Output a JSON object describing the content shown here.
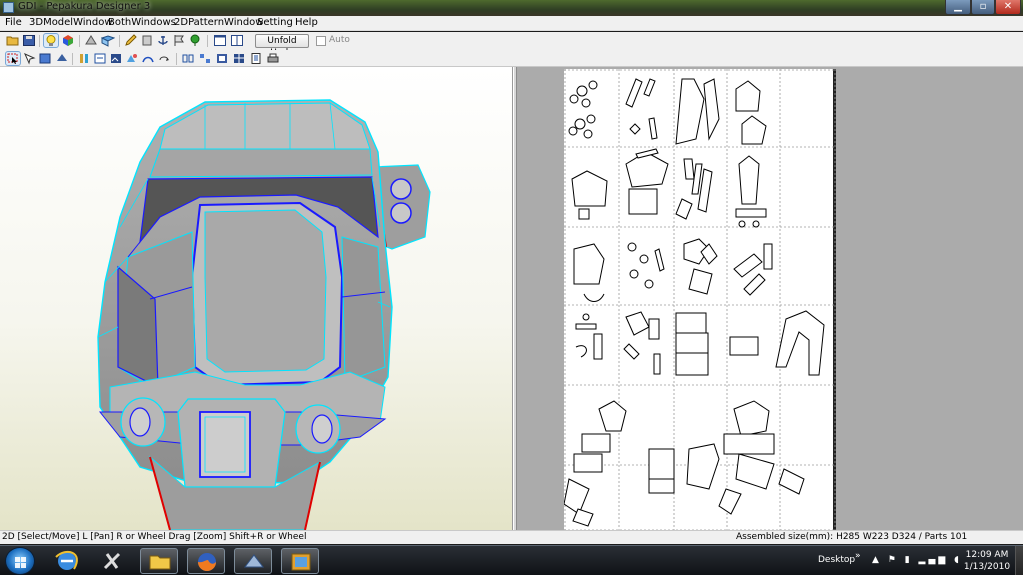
{
  "window": {
    "title": "GDI - Pepakura Designer 3"
  },
  "menu": [
    "File",
    "3DModelWindow",
    "BothWindows",
    "2DPatternWindow",
    "Setting",
    "Help"
  ],
  "toolbar": {
    "unfold_undo_label": "Unfold Undo",
    "auto_label": "Auto",
    "auto_checked": false
  },
  "status": {
    "left": "2D [Select/Move] L [Pan] R or Wheel Drag [Zoom] Shift+R or Wheel",
    "right": "Assembled size(mm): H285 W223 D324 / Parts 101"
  },
  "taskbar": {
    "apps": [
      "windows-start-icon",
      "internet-explorer-icon",
      "tools-icon",
      "file-explorer-icon",
      "firefox-icon",
      "app-icon",
      "pepakura-icon"
    ],
    "desktop_label": "Desktop",
    "clock_time": "12:09 AM",
    "clock_date": "1/13/2010"
  },
  "colors": {
    "mesh_face": "#9b9b9b",
    "mesh_edge": "#00e5ff",
    "mesh_outline": "#1a1aff",
    "cut_edge": "#e00000"
  }
}
